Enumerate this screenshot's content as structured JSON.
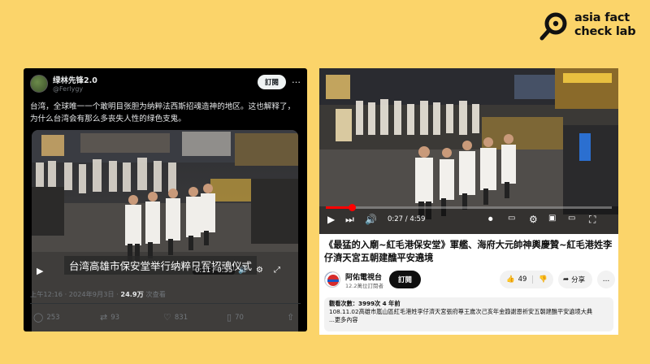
{
  "brand": {
    "logo_text_line1": "asia fact",
    "logo_text_line2": "check lab"
  },
  "tweet": {
    "display_name": "绿林先锋2.0",
    "handle": "@Ferlygy",
    "subscribe_label": "訂閱",
    "more_label": "…",
    "text": "台湾，全球唯一一个敢明目张胆为纳粹法西斯招魂造神的地区。这也解释了，为什么台湾会有那么多丧失人性的绿色支鬼。",
    "video": {
      "subtitle": "台湾高雄市保安堂举行纳粹日军招魂仪式",
      "time": "0:11 / 0:55"
    },
    "meta": {
      "time": "上午12:16 · 2024年9月3日 · ",
      "views_value": "24.9万",
      "views_label": " 次查看"
    },
    "stats": {
      "replies": "253",
      "reposts": "93",
      "likes": "831",
      "bookmarks": "70"
    }
  },
  "youtube": {
    "player": {
      "time": "0:27 / 4:59",
      "progress": 0.09
    },
    "title": "《最猛的入廟~紅毛港保安堂》軍艦、海府大元帥神輿慶贊~紅毛港姓李仔濟天宮五朝建醮平安遶境",
    "channel_name": "阿佑電視台",
    "channel_subs": "12.2萬位訂閱者",
    "subscribe_label": "訂閱",
    "likes": "49",
    "share_label": "分享",
    "more_label": "…",
    "description": {
      "views_line": "觀看次數：3999次  4 年前",
      "text": "108.11.02高雄市嵐山區紅毛港姓李仔濟天宮張府尊王歲次己亥年金籙謝恩祈安五朝建醮平安遶境大典",
      "more": "...更多內容"
    }
  },
  "colors": {
    "background": "#fbd46a",
    "x_background": "#000000",
    "youtube_red": "#ff0000"
  }
}
